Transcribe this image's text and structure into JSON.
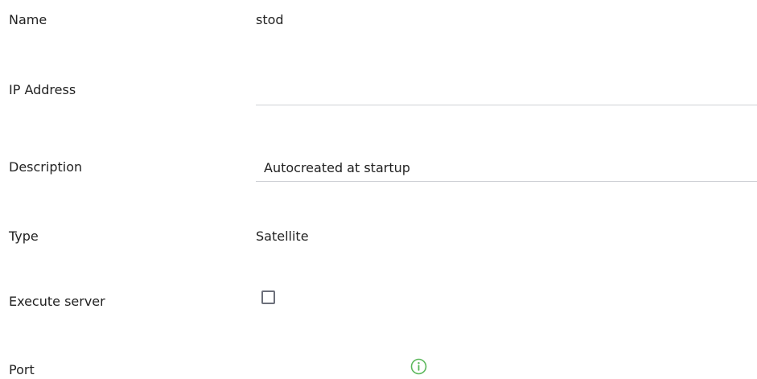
{
  "form": {
    "name": {
      "label": "Name",
      "value": "stod"
    },
    "ip_address": {
      "label": "IP Address",
      "value": ""
    },
    "description": {
      "label": "Description",
      "value": "Autocreated at startup"
    },
    "type": {
      "label": "Type",
      "value": "Satellite"
    },
    "execute_server": {
      "label": "Execute server",
      "checked": false
    },
    "port": {
      "label": "Port",
      "info_icon": "info-circle-icon"
    }
  },
  "colors": {
    "text": "#222222",
    "underline": "#cfd1d6",
    "checkbox_border": "#6c6f7a",
    "info_icon": "#5cb85c"
  }
}
